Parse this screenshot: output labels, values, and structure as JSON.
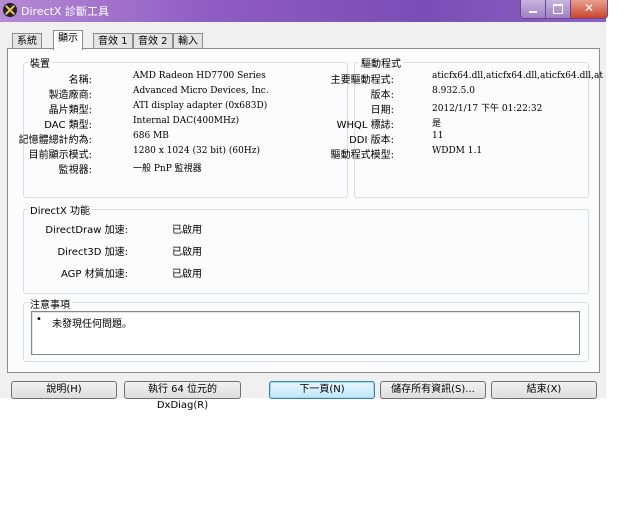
{
  "window": {
    "title": "DirectX 診斷工具"
  },
  "tabs": [
    {
      "label": "系統"
    },
    {
      "label": "顯示"
    },
    {
      "label": "音效 1"
    },
    {
      "label": "音效 2"
    },
    {
      "label": "輸入"
    }
  ],
  "device": {
    "title": "裝置",
    "rows": [
      {
        "label": "名稱:",
        "value": "AMD Radeon HD7700 Series"
      },
      {
        "label": "製造廠商:",
        "value": "Advanced Micro Devices, Inc."
      },
      {
        "label": "晶片類型:",
        "value": "ATI display adapter (0x683D)"
      },
      {
        "label": "DAC 類型:",
        "value": "Internal DAC(400MHz)"
      },
      {
        "label": "記憶體總計約為:",
        "value": "686 MB"
      },
      {
        "label": "目前顯示模式:",
        "value": "1280 x 1024 (32 bit) (60Hz)"
      },
      {
        "label": "監視器:",
        "value": "一般 PnP 監視器"
      }
    ]
  },
  "driver": {
    "title": "驅動程式",
    "rows": [
      {
        "label": "主要驅動程式:",
        "value": "aticfx64.dll,aticfx64.dll,aticfx64.dll,at"
      },
      {
        "label": "版本:",
        "value": "8.932.5.0"
      },
      {
        "label": "日期:",
        "value": "2012/1/17 下午 01:22:32"
      },
      {
        "label": "WHQL 標誌:",
        "value": "是"
      },
      {
        "label": "DDI 版本:",
        "value": "11"
      },
      {
        "label": "驅動程式模型:",
        "value": "WDDM 1.1"
      }
    ]
  },
  "directx": {
    "title": "DirectX 功能",
    "rows": [
      {
        "label": "DirectDraw 加速:",
        "value": "已啟用"
      },
      {
        "label": "Direct3D 加速:",
        "value": "已啟用"
      },
      {
        "label": "AGP 材質加速:",
        "value": "已啟用"
      }
    ]
  },
  "notes": {
    "title": "注意事項",
    "items": [
      "未發現任何問題。"
    ]
  },
  "buttons": {
    "help": "說明(H)",
    "run64": "執行 64 位元的 DxDiag(R)",
    "next": "下一頁(N)",
    "save": "儲存所有資訊(S)...",
    "exit": "結束(X)"
  }
}
